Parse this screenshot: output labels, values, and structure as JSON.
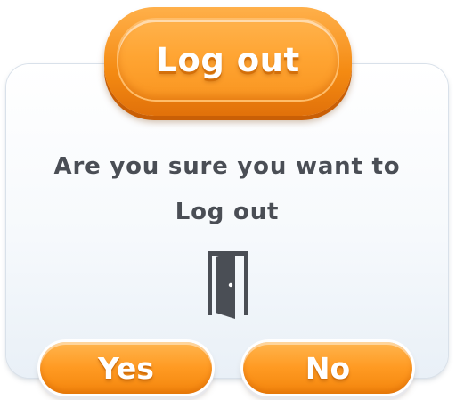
{
  "dialog": {
    "title": "Log out",
    "message_line1": "Are you sure you want to",
    "message_line2": "Log out",
    "icon": "door-open-icon",
    "buttons": {
      "yes_label": "Yes",
      "no_label": "No"
    }
  },
  "colors": {
    "accent_orange": "#ff9a22",
    "text_dark": "#4a4e55",
    "card_background": "#f6f9fc"
  }
}
